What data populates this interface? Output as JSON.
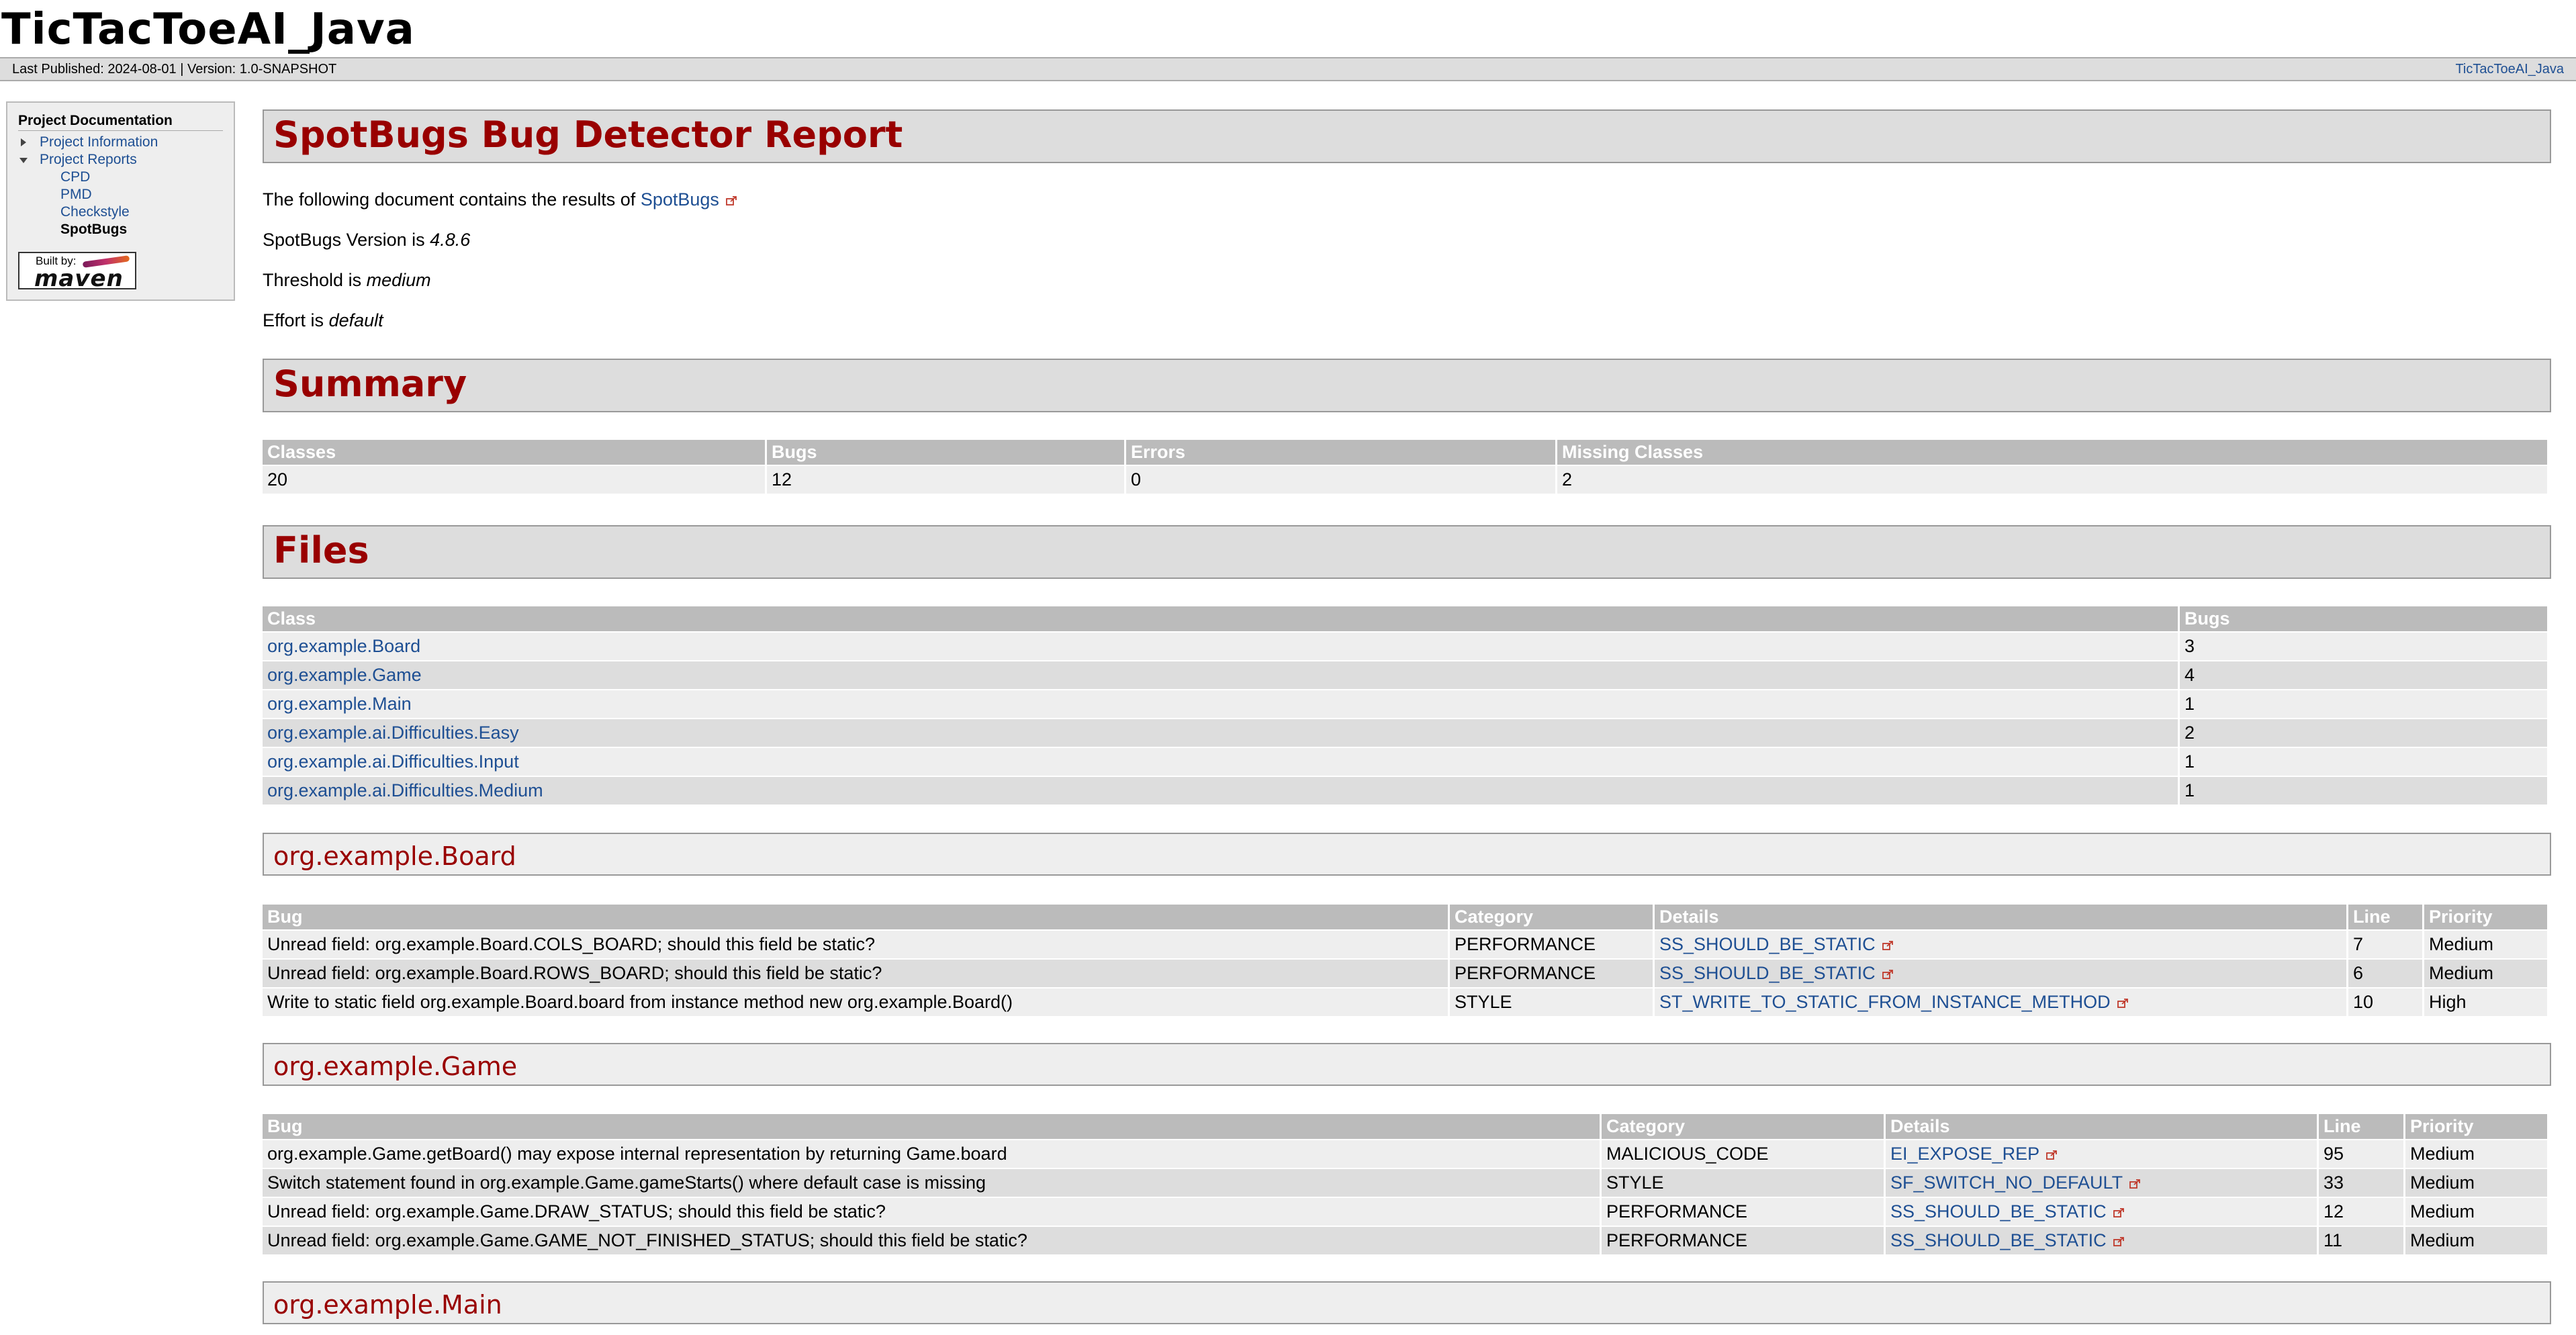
{
  "site": {
    "title": "TicTacToeAI_Java",
    "published": "Last Published: 2024-08-01",
    "separator": "|",
    "version": "Version: 1.0-SNAPSHOT",
    "right_link": "TicTacToeAI_Java"
  },
  "nav": {
    "heading": "Project Documentation",
    "items": [
      {
        "label": "Project Information"
      },
      {
        "label": "Project Reports"
      },
      {
        "label": "CPD"
      },
      {
        "label": "PMD"
      },
      {
        "label": "Checkstyle"
      },
      {
        "label": "SpotBugs"
      }
    ],
    "badge": {
      "built_by": "Built by:",
      "word": "maven"
    }
  },
  "report": {
    "title": "SpotBugs Bug Detector Report",
    "intro_text": "The following document contains the results of",
    "intro_link": "SpotBugs",
    "version_label": "SpotBugs Version is",
    "version_value": "4.8.6",
    "threshold_label": "Threshold is",
    "threshold_value": "medium",
    "effort_label": "Effort is",
    "effort_value": "default"
  },
  "summary": {
    "heading": "Summary",
    "headers": [
      "Classes",
      "Bugs",
      "Errors",
      "Missing Classes"
    ],
    "row": [
      "20",
      "12",
      "0",
      "2"
    ]
  },
  "files": {
    "heading": "Files",
    "headers": [
      "Class",
      "Bugs"
    ],
    "rows": [
      [
        "org.example.Board",
        "3"
      ],
      [
        "org.example.Game",
        "4"
      ],
      [
        "org.example.Main",
        "1"
      ],
      [
        "org.example.ai.Difficulties.Easy",
        "2"
      ],
      [
        "org.example.ai.Difficulties.Input",
        "1"
      ],
      [
        "org.example.ai.Difficulties.Medium",
        "1"
      ]
    ]
  },
  "board_section": {
    "heading": "org.example.Board",
    "headers": [
      "Bug",
      "Category",
      "Details",
      "Line",
      "Priority"
    ],
    "rows": [
      [
        "Unread field: org.example.Board.COLS_BOARD; should this field be static?",
        "PERFORMANCE",
        "SS_SHOULD_BE_STATIC",
        "7",
        "Medium"
      ],
      [
        "Unread field: org.example.Board.ROWS_BOARD; should this field be static?",
        "PERFORMANCE",
        "SS_SHOULD_BE_STATIC",
        "6",
        "Medium"
      ],
      [
        "Write to static field org.example.Board.board from instance method new org.example.Board()",
        "STYLE",
        "ST_WRITE_TO_STATIC_FROM_INSTANCE_METHOD",
        "10",
        "High"
      ]
    ]
  },
  "game_section": {
    "heading": "org.example.Game",
    "headers": [
      "Bug",
      "Category",
      "Details",
      "Line",
      "Priority"
    ],
    "rows": [
      [
        "org.example.Game.getBoard() may expose internal representation by returning Game.board",
        "MALICIOUS_CODE",
        "EI_EXPOSE_REP",
        "95",
        "Medium"
      ],
      [
        "Switch statement found in org.example.Game.gameStarts() where default case is missing",
        "STYLE",
        "SF_SWITCH_NO_DEFAULT",
        "33",
        "Medium"
      ],
      [
        "Unread field: org.example.Game.DRAW_STATUS; should this field be static?",
        "PERFORMANCE",
        "SS_SHOULD_BE_STATIC",
        "12",
        "Medium"
      ],
      [
        "Unread field: org.example.Game.GAME_NOT_FINISHED_STATUS; should this field be static?",
        "PERFORMANCE",
        "SS_SHOULD_BE_STATIC",
        "11",
        "Medium"
      ]
    ]
  },
  "main_section": {
    "heading": "org.example.Main"
  }
}
